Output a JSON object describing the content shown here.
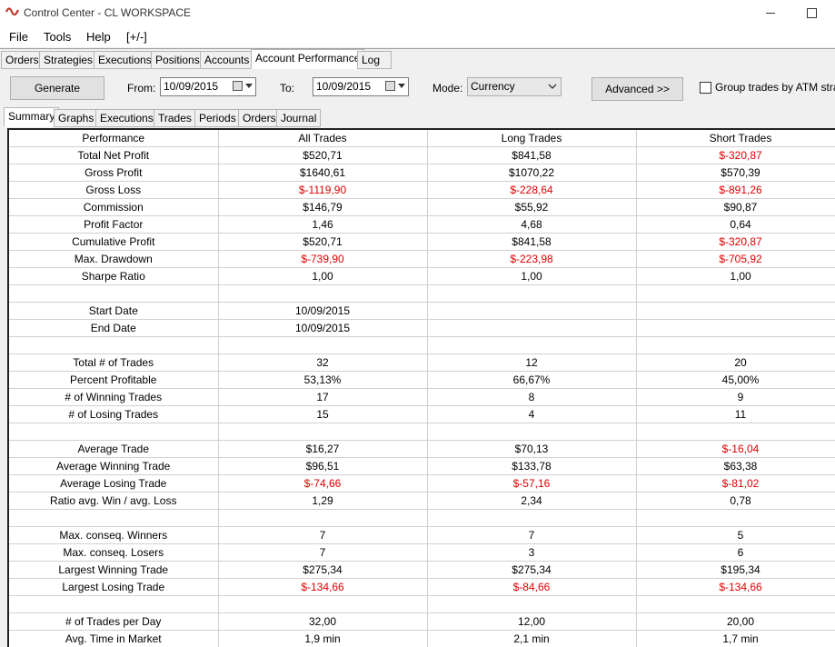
{
  "window": {
    "title": "Control Center - CL WORKSPACE",
    "controls": {
      "minimize": "—",
      "maximize": "☐"
    }
  },
  "menu": {
    "items": [
      "File",
      "Tools",
      "Help",
      "[+/-]"
    ]
  },
  "main_tabs": [
    "Orders",
    "Strategies",
    "Executions",
    "Positions",
    "Accounts",
    "Account Performance",
    "Log"
  ],
  "active_main_tab": "Account Performance",
  "toolbar": {
    "generate_label": "Generate",
    "from_label": "From:",
    "from_value": "10/09/2015",
    "to_label": "To:",
    "to_value": "10/09/2015",
    "mode_label": "Mode:",
    "mode_value": "Currency",
    "advanced_label": "Advanced >>",
    "group_label": "Group trades by ATM strat"
  },
  "sub_tabs": [
    "Summary",
    "Graphs",
    "Executions",
    "Trades",
    "Periods",
    "Orders",
    "Journal"
  ],
  "active_sub_tab": "Summary",
  "table": {
    "headers": [
      "Performance",
      "All Trades",
      "Long Trades",
      "Short Trades"
    ],
    "rows": [
      [
        "Total Net Profit",
        "$520,71",
        "$841,58",
        "$-320,87"
      ],
      [
        "Gross Profit",
        "$1640,61",
        "$1070,22",
        "$570,39"
      ],
      [
        "Gross Loss",
        "$-1119,90",
        "$-228,64",
        "$-891,26"
      ],
      [
        "Commission",
        "$146,79",
        "$55,92",
        "$90,87"
      ],
      [
        "Profit Factor",
        "1,46",
        "4,68",
        "0,64"
      ],
      [
        "Cumulative Profit",
        "$520,71",
        "$841,58",
        "$-320,87"
      ],
      [
        "Max. Drawdown",
        "$-739,90",
        "$-223,98",
        "$-705,92"
      ],
      [
        "Sharpe Ratio",
        "1,00",
        "1,00",
        "1,00"
      ],
      [
        "",
        "",
        "",
        ""
      ],
      [
        "Start Date",
        "10/09/2015",
        "",
        ""
      ],
      [
        "End Date",
        "10/09/2015",
        "",
        ""
      ],
      [
        "",
        "",
        "",
        ""
      ],
      [
        "Total # of Trades",
        "32",
        "12",
        "20"
      ],
      [
        "Percent Profitable",
        "53,13%",
        "66,67%",
        "45,00%"
      ],
      [
        "# of Winning Trades",
        "17",
        "8",
        "9"
      ],
      [
        "# of Losing Trades",
        "15",
        "4",
        "11"
      ],
      [
        "",
        "",
        "",
        ""
      ],
      [
        "Average Trade",
        "$16,27",
        "$70,13",
        "$-16,04"
      ],
      [
        "Average Winning Trade",
        "$96,51",
        "$133,78",
        "$63,38"
      ],
      [
        "Average Losing Trade",
        "$-74,66",
        "$-57,16",
        "$-81,02"
      ],
      [
        "Ratio avg. Win / avg. Loss",
        "1,29",
        "2,34",
        "0,78"
      ],
      [
        "",
        "",
        "",
        ""
      ],
      [
        "Max. conseq. Winners",
        "7",
        "7",
        "5"
      ],
      [
        "Max. conseq. Losers",
        "7",
        "3",
        "6"
      ],
      [
        "Largest Winning Trade",
        "$275,34",
        "$275,34",
        "$195,34"
      ],
      [
        "Largest Losing Trade",
        "$-134,66",
        "$-84,66",
        "$-134,66"
      ],
      [
        "",
        "",
        "",
        ""
      ],
      [
        "# of Trades per Day",
        "32,00",
        "12,00",
        "20,00"
      ],
      [
        "Avg. Time in Market",
        "1,9 min",
        "2,1 min",
        "1,7 min"
      ]
    ]
  },
  "colors": {
    "negative": "#e00000",
    "logo": "#c0392b"
  }
}
